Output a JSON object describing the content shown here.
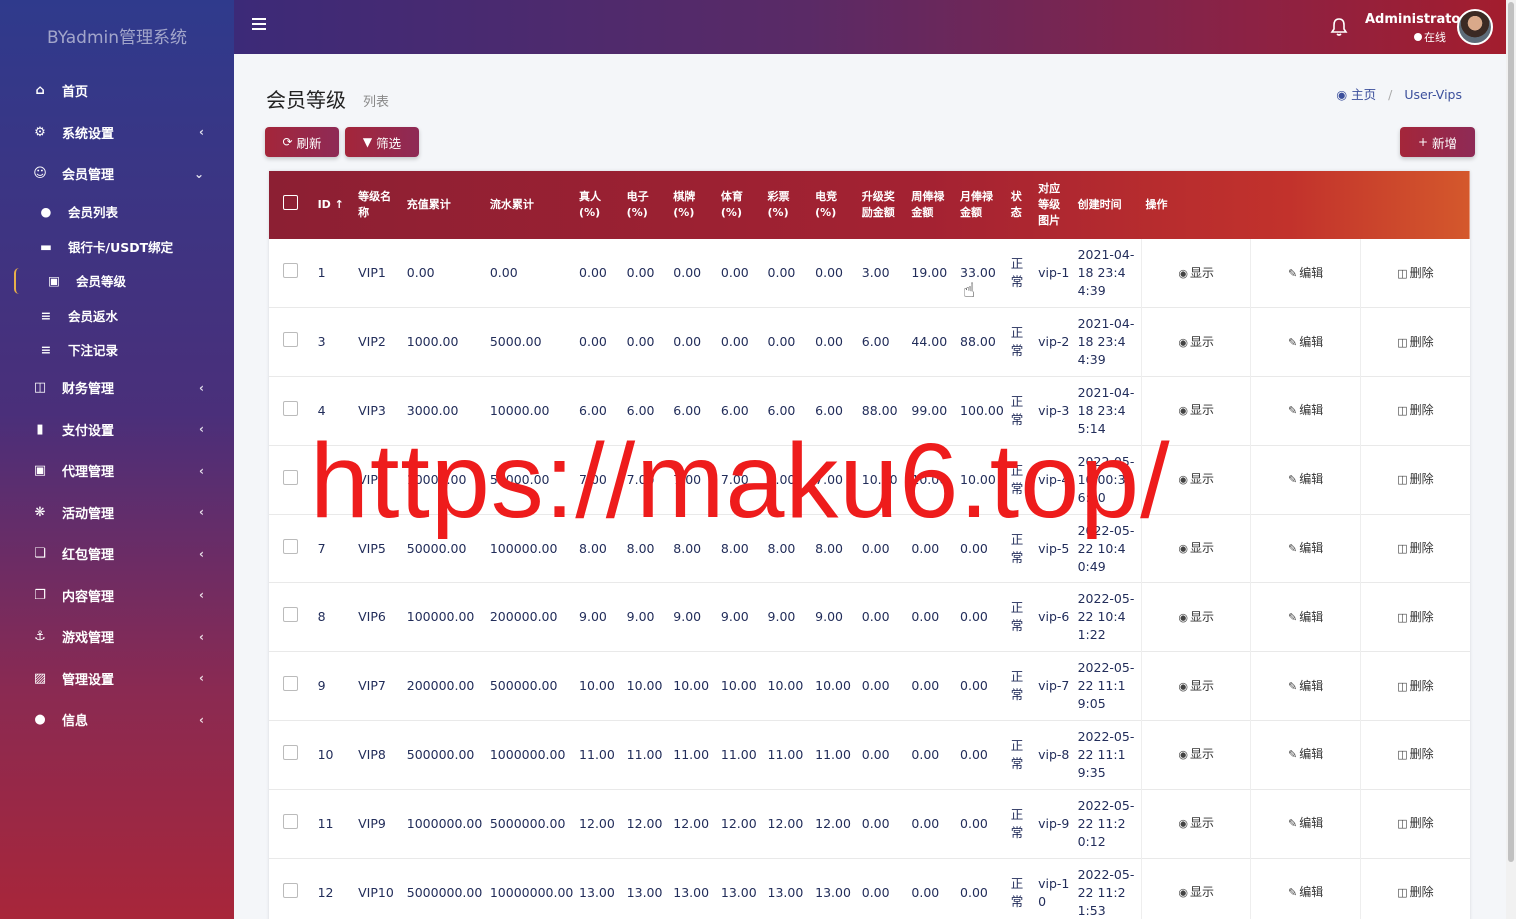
{
  "app": {
    "brand": "BYadmin管理系统"
  },
  "header": {
    "user_name": "Administrator",
    "user_status": "在线"
  },
  "sidebar": {
    "items": [
      {
        "label": "首页",
        "icon": "home-icon",
        "has_chevron": false
      },
      {
        "label": "系统设置",
        "icon": "gears-icon",
        "has_chevron": true
      },
      {
        "label": "会员管理",
        "icon": "user-outline-icon",
        "has_chevron": true,
        "expanded": true
      },
      {
        "label": "财务管理",
        "icon": "database-icon",
        "has_chevron": true
      },
      {
        "label": "支付设置",
        "icon": "bookmark-icon",
        "has_chevron": true
      },
      {
        "label": "代理管理",
        "icon": "id-badge-icon",
        "has_chevron": true
      },
      {
        "label": "活动管理",
        "icon": "pinwheel-icon",
        "has_chevron": true
      },
      {
        "label": "红包管理",
        "icon": "window-restore-icon",
        "has_chevron": true
      },
      {
        "label": "内容管理",
        "icon": "clone-icon",
        "has_chevron": true
      },
      {
        "label": "游戏管理",
        "icon": "anchor-icon",
        "has_chevron": true
      },
      {
        "label": "管理设置",
        "icon": "id-card-icon",
        "has_chevron": true
      },
      {
        "label": "信息",
        "icon": "comments-icon",
        "has_chevron": true
      }
    ],
    "sub_items": [
      {
        "label": "会员列表",
        "icon": "user-icon"
      },
      {
        "label": "银行卡/USDT绑定",
        "icon": "credit-card-icon"
      },
      {
        "label": "会员等级",
        "icon": "id-badge-icon",
        "active": true
      },
      {
        "label": "会员返水",
        "icon": "list-icon"
      },
      {
        "label": "下注记录",
        "icon": "align-icon"
      }
    ]
  },
  "page": {
    "title": "会员等级",
    "subtitle": "列表",
    "breadcrumb": {
      "home": "主页",
      "current": "User-Vips"
    }
  },
  "toolbar": {
    "refresh_label": "刷新",
    "filter_label": "筛选",
    "add_label": "新增"
  },
  "table": {
    "headers": {
      "id": "ID",
      "name": "等级名称",
      "recharge": "充值累计",
      "turnover": "流水累计",
      "live": "真人(%)",
      "slots": "电子(%)",
      "chess": "棋牌(%)",
      "sports": "体育(%)",
      "lottery": "彩票(%)",
      "esports": "电竞(%)",
      "upgrade_bonus": "升级奖励金额",
      "weekly_salary": "周俸禄金额",
      "monthly_salary": "月俸禄金额",
      "status": "状态",
      "image": "对应等级图片",
      "created": "创建时间",
      "actions": "操作"
    },
    "action_labels": {
      "show": "显示",
      "edit": "编辑",
      "delete": "删除"
    },
    "rows": [
      {
        "id": "1",
        "name": "VIP1",
        "recharge": "0.00",
        "turnover": "0.00",
        "live": "0.00",
        "slots": "0.00",
        "chess": "0.00",
        "sports": "0.00",
        "lottery": "0.00",
        "esports": "0.00",
        "upgrade": "3.00",
        "weekly": "19.00",
        "monthly": "33.00",
        "status": "正常",
        "image": "vip-1",
        "created": "2021-04-18 23:44:39"
      },
      {
        "id": "3",
        "name": "VIP2",
        "recharge": "1000.00",
        "turnover": "5000.00",
        "live": "0.00",
        "slots": "0.00",
        "chess": "0.00",
        "sports": "0.00",
        "lottery": "0.00",
        "esports": "0.00",
        "upgrade": "6.00",
        "weekly": "44.00",
        "monthly": "88.00",
        "status": "正常",
        "image": "vip-2",
        "created": "2021-04-18 23:44:39"
      },
      {
        "id": "4",
        "name": "VIP3",
        "recharge": "3000.00",
        "turnover": "10000.00",
        "live": "6.00",
        "slots": "6.00",
        "chess": "6.00",
        "sports": "6.00",
        "lottery": "6.00",
        "esports": "6.00",
        "upgrade": "88.00",
        "weekly": "99.00",
        "monthly": "100.00",
        "status": "正常",
        "image": "vip-3",
        "created": "2021-04-18 23:45:14"
      },
      {
        "id": "6",
        "name": "VIP4",
        "recharge": "10000.00",
        "turnover": "50000.00",
        "live": "7.00",
        "slots": "7.00",
        "chess": "7.00",
        "sports": "7.00",
        "lottery": "7.00",
        "esports": "7.00",
        "upgrade": "10.00",
        "weekly": "10.00",
        "monthly": "10.00",
        "status": "正常",
        "image": "vip-4",
        "created": "2022-05-10 00:36:40"
      },
      {
        "id": "7",
        "name": "VIP5",
        "recharge": "50000.00",
        "turnover": "100000.00",
        "live": "8.00",
        "slots": "8.00",
        "chess": "8.00",
        "sports": "8.00",
        "lottery": "8.00",
        "esports": "8.00",
        "upgrade": "0.00",
        "weekly": "0.00",
        "monthly": "0.00",
        "status": "正常",
        "image": "vip-5",
        "created": "2022-05-22 10:40:49"
      },
      {
        "id": "8",
        "name": "VIP6",
        "recharge": "100000.00",
        "turnover": "200000.00",
        "live": "9.00",
        "slots": "9.00",
        "chess": "9.00",
        "sports": "9.00",
        "lottery": "9.00",
        "esports": "9.00",
        "upgrade": "0.00",
        "weekly": "0.00",
        "monthly": "0.00",
        "status": "正常",
        "image": "vip-6",
        "created": "2022-05-22 10:41:22"
      },
      {
        "id": "9",
        "name": "VIP7",
        "recharge": "200000.00",
        "turnover": "500000.00",
        "live": "10.00",
        "slots": "10.00",
        "chess": "10.00",
        "sports": "10.00",
        "lottery": "10.00",
        "esports": "10.00",
        "upgrade": "0.00",
        "weekly": "0.00",
        "monthly": "0.00",
        "status": "正常",
        "image": "vip-7",
        "created": "2022-05-22 11:19:05"
      },
      {
        "id": "10",
        "name": "VIP8",
        "recharge": "500000.00",
        "turnover": "1000000.00",
        "live": "11.00",
        "slots": "11.00",
        "chess": "11.00",
        "sports": "11.00",
        "lottery": "11.00",
        "esports": "11.00",
        "upgrade": "0.00",
        "weekly": "0.00",
        "monthly": "0.00",
        "status": "正常",
        "image": "vip-8",
        "created": "2022-05-22 11:19:35"
      },
      {
        "id": "11",
        "name": "VIP9",
        "recharge": "1000000.00",
        "turnover": "5000000.00",
        "live": "12.00",
        "slots": "12.00",
        "chess": "12.00",
        "sports": "12.00",
        "lottery": "12.00",
        "esports": "12.00",
        "upgrade": "0.00",
        "weekly": "0.00",
        "monthly": "0.00",
        "status": "正常",
        "image": "vip-9",
        "created": "2022-05-22 11:20:12"
      },
      {
        "id": "12",
        "name": "VIP10",
        "recharge": "5000000.00",
        "turnover": "10000000.00",
        "live": "13.00",
        "slots": "13.00",
        "chess": "13.00",
        "sports": "13.00",
        "lottery": "13.00",
        "esports": "13.00",
        "upgrade": "0.00",
        "weekly": "0.00",
        "monthly": "0.00",
        "status": "正常",
        "image": "vip-10",
        "created": "2022-05-22 11:21:53"
      }
    ]
  },
  "watermark": "https://maku6.top/",
  "colors": {
    "accent": "#a4263a",
    "link": "#3b4f9c",
    "watermark": "#ee1c1c"
  }
}
